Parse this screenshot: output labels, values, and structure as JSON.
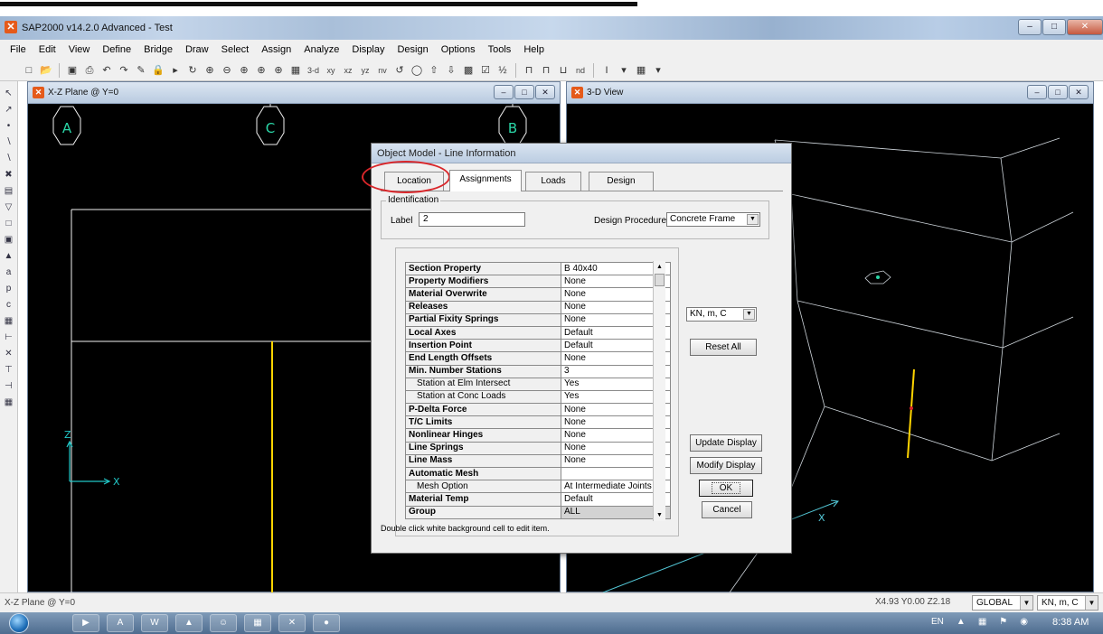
{
  "window": {
    "title": "SAP2000 v14.2.0 Advanced  - Test"
  },
  "menu": [
    "File",
    "Edit",
    "View",
    "Define",
    "Bridge",
    "Draw",
    "Select",
    "Assign",
    "Analyze",
    "Display",
    "Design",
    "Options",
    "Tools",
    "Help"
  ],
  "toolbar_text": {
    "view_3d": "3-d",
    "view_xy": "xy",
    "view_xz": "xz",
    "view_yz": "yz",
    "view_nv": "nv",
    "nd": "nd"
  },
  "left_panel": {
    "title": "X-Z Plane @ Y=0",
    "gridlines": [
      "A",
      "C",
      "B"
    ],
    "axis_z": "Z",
    "axis_x": "X"
  },
  "right_panel": {
    "title": "3-D View"
  },
  "dialog": {
    "title": "Object Model - Line Information",
    "tabs": [
      "Location",
      "Assignments",
      "Loads",
      "Design"
    ],
    "active_tab": "Assignments",
    "identification_label": "Identification",
    "label_caption": "Label",
    "label_value": "2",
    "design_procedure_caption": "Design Procedure",
    "design_procedure_value": "Concrete Frame",
    "properties": [
      {
        "name": "Section Property",
        "value": "B 40x40"
      },
      {
        "name": "Property Modifiers",
        "value": "None"
      },
      {
        "name": "Material Overwrite",
        "value": "None"
      },
      {
        "name": "Releases",
        "value": "None"
      },
      {
        "name": "Partial Fixity Springs",
        "value": "None"
      },
      {
        "name": "Local Axes",
        "value": "Default"
      },
      {
        "name": "Insertion Point",
        "value": "Default"
      },
      {
        "name": "End Length Offsets",
        "value": "None"
      },
      {
        "name": "Min. Number Stations",
        "value": "3"
      },
      {
        "name": "Station at Elm Intersect",
        "value": "Yes",
        "sub": true
      },
      {
        "name": "Station at Conc Loads",
        "value": "Yes",
        "sub": true
      },
      {
        "name": "P-Delta Force",
        "value": "None"
      },
      {
        "name": "T/C Limits",
        "value": "None"
      },
      {
        "name": "Nonlinear Hinges",
        "value": "None"
      },
      {
        "name": "Line Springs",
        "value": "None"
      },
      {
        "name": "Line Mass",
        "value": "None"
      },
      {
        "name": "Automatic Mesh",
        "value": ""
      },
      {
        "name": "Mesh Option",
        "value": "At Intermediate Joints",
        "sub": true
      },
      {
        "name": "Material Temp",
        "value": "Default"
      },
      {
        "name": "Group",
        "value": "ALL",
        "selected": true
      }
    ],
    "units_value": "KN, m, C",
    "reset_all": "Reset All",
    "update_display": "Update Display",
    "modify_display": "Modify Display",
    "ok": "OK",
    "cancel": "Cancel",
    "note": "Double click white background cell to edit item."
  },
  "status": {
    "left": "X-Z Plane @ Y=0",
    "coords": "X4.93  Y0.00  Z2.18",
    "coord_system": "GLOBAL",
    "units": "KN, m, C"
  },
  "taskbar": {
    "lang": "EN",
    "clock": "8:38 AM"
  },
  "colors": {
    "frame_highlight": "#ffd400",
    "wire": "#53c7d6",
    "annotation": "#d9262a"
  }
}
